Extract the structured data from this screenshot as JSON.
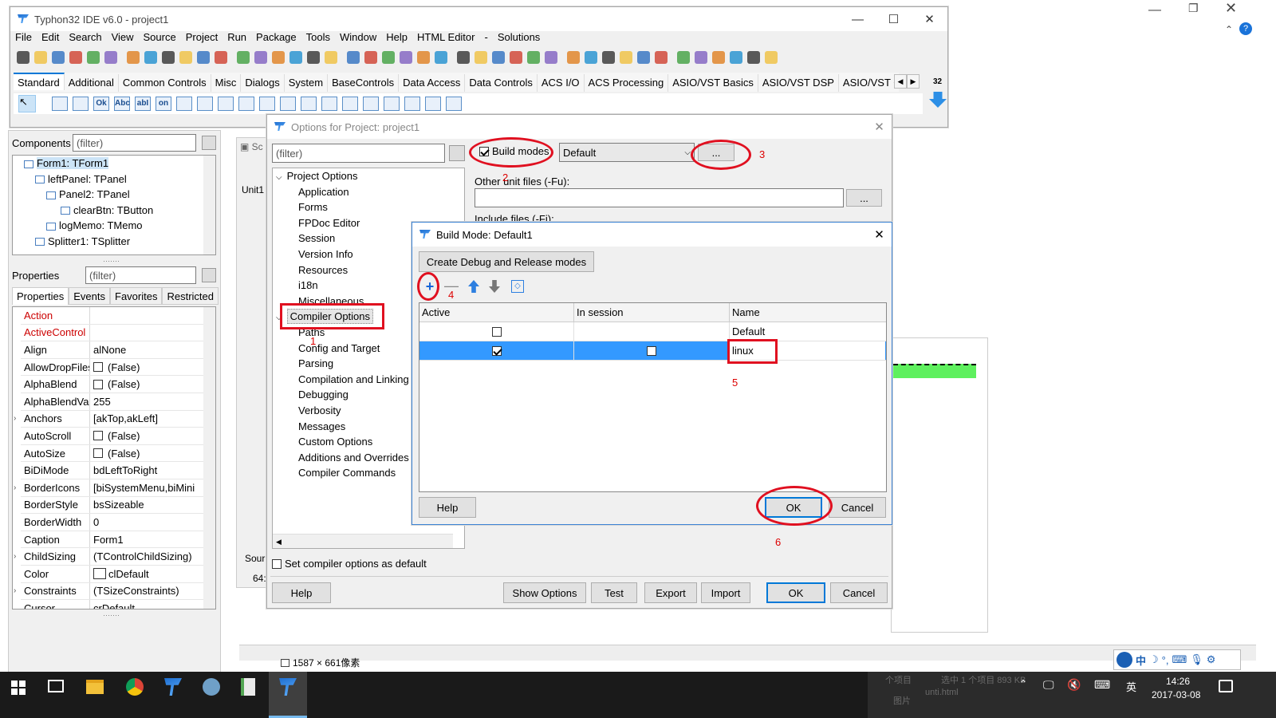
{
  "ide": {
    "title": "Typhon32 IDE v6.0 - project1",
    "menu": [
      "File",
      "Edit",
      "Search",
      "View",
      "Source",
      "Project",
      "Run",
      "Package",
      "Tools",
      "Window",
      "Help",
      "HTML Editor",
      "-",
      "Solutions"
    ],
    "palette_tabs": [
      "Standard",
      "Additional",
      "Common Controls",
      "Misc",
      "Dialogs",
      "System",
      "BaseControls",
      "Data Access",
      "Data Controls",
      "ACS I/O",
      "ACS Processing",
      "ASIO/VST Basics",
      "ASIO/VST DSP",
      "ASIO/VST GU"
    ],
    "bitness": "32",
    "palette_small": [
      "Ok",
      "Abc",
      "abI",
      "on"
    ]
  },
  "components": {
    "label": "Components",
    "filter_placeholder": "(filter)",
    "tree": [
      "Form1: TForm1",
      "leftPanel: TPanel",
      "Panel2: TPanel",
      "clearBtn: TButton",
      "logMemo: TMemo",
      "Splitter1: TSplitter"
    ]
  },
  "properties": {
    "label": "Properties",
    "filter_placeholder": "(filter)",
    "tabs": [
      "Properties",
      "Events",
      "Favorites",
      "Restricted"
    ],
    "rows": [
      {
        "k": "Action",
        "v": "",
        "red": true
      },
      {
        "k": "ActiveControl",
        "v": "",
        "red": true
      },
      {
        "k": "Align",
        "v": "alNone"
      },
      {
        "k": "AllowDropFiles",
        "v": "(False)",
        "chk": true
      },
      {
        "k": "AlphaBlend",
        "v": "(False)",
        "chk": true
      },
      {
        "k": "AlphaBlendVal",
        "v": "255"
      },
      {
        "k": "Anchors",
        "v": "[akTop,akLeft]",
        "exp": true
      },
      {
        "k": "AutoScroll",
        "v": "(False)",
        "chk": true
      },
      {
        "k": "AutoSize",
        "v": "(False)",
        "chk": true
      },
      {
        "k": "BiDiMode",
        "v": "bdLeftToRight"
      },
      {
        "k": "BorderIcons",
        "v": "[biSystemMenu,biMini",
        "exp": true
      },
      {
        "k": "BorderStyle",
        "v": "bsSizeable"
      },
      {
        "k": "BorderWidth",
        "v": "0"
      },
      {
        "k": "Caption",
        "v": "Form1"
      },
      {
        "k": "ChildSizing",
        "v": "(TControlChildSizing)",
        "exp": true
      },
      {
        "k": "Color",
        "v": "clDefault",
        "swatch": true
      },
      {
        "k": "Constraints",
        "v": "(TSizeConstraints)",
        "exp": true
      },
      {
        "k": "Cursor",
        "v": "crDefault"
      }
    ]
  },
  "editor_fragment": {
    "tab": "Sc",
    "unit": "Unit1",
    "bottom": "Sour",
    "pos": "64:"
  },
  "options_dialog": {
    "title": "Options for Project: project1",
    "filter_placeholder": "(filter)",
    "build_modes_label": "Build modes",
    "build_mode_value": "Default",
    "dots": "...",
    "other_unit_label": "Other unit files (-Fu):",
    "include_label": "Include files (-Fi):",
    "tree": [
      {
        "t": "Project Options",
        "lvl": 0
      },
      {
        "t": "Application",
        "lvl": 1
      },
      {
        "t": "Forms",
        "lvl": 1
      },
      {
        "t": "FPDoc Editor",
        "lvl": 1
      },
      {
        "t": "Session",
        "lvl": 1
      },
      {
        "t": "Version Info",
        "lvl": 1
      },
      {
        "t": "Resources",
        "lvl": 1
      },
      {
        "t": "i18n",
        "lvl": 1
      },
      {
        "t": "Miscellaneous",
        "lvl": 1
      },
      {
        "t": "Compiler Options",
        "lvl": 0,
        "sel": true
      },
      {
        "t": "Paths",
        "lvl": 1
      },
      {
        "t": "Config and Target",
        "lvl": 1
      },
      {
        "t": "Parsing",
        "lvl": 1
      },
      {
        "t": "Compilation and Linking",
        "lvl": 1
      },
      {
        "t": "Debugging",
        "lvl": 1
      },
      {
        "t": "Verbosity",
        "lvl": 1
      },
      {
        "t": "Messages",
        "lvl": 1
      },
      {
        "t": "Custom Options",
        "lvl": 1
      },
      {
        "t": "Additions and Overrides",
        "lvl": 1
      },
      {
        "t": "Compiler Commands",
        "lvl": 1
      }
    ],
    "set_default_label": "Set compiler options as default",
    "buttons": {
      "help": "Help",
      "show_options": "Show Options",
      "test": "Test",
      "export": "Export",
      "import": "Import",
      "ok": "OK",
      "cancel": "Cancel"
    }
  },
  "build_mode_dialog": {
    "title": "Build Mode: Default1",
    "create_btn": "Create Debug and Release modes",
    "columns": [
      "Active",
      "In session",
      "Name"
    ],
    "rows": [
      {
        "active": false,
        "session": null,
        "name": "Default",
        "selected": false
      },
      {
        "active": true,
        "session": false,
        "name": "linux",
        "selected": true
      }
    ],
    "buttons": {
      "help": "Help",
      "ok": "OK",
      "cancel": "Cancel"
    }
  },
  "annotations": [
    "1",
    "2",
    "3",
    "4",
    "5",
    "6"
  ],
  "statusbar": {
    "dims": "1587 × 661像素"
  },
  "taskbar": {
    "time": "14:26",
    "date": "2017-03-08",
    "ime": [
      "中",
      "英"
    ],
    "bg_text": [
      "个项目",
      "选中 1 个项目 893 KB",
      "图片",
      "unti.html"
    ]
  },
  "colors": {
    "accent": "#0078d7",
    "selection": "#3399ff",
    "annotation": "#e01020",
    "green": "#5ef05e",
    "taskbar": "#1a1a1a"
  }
}
